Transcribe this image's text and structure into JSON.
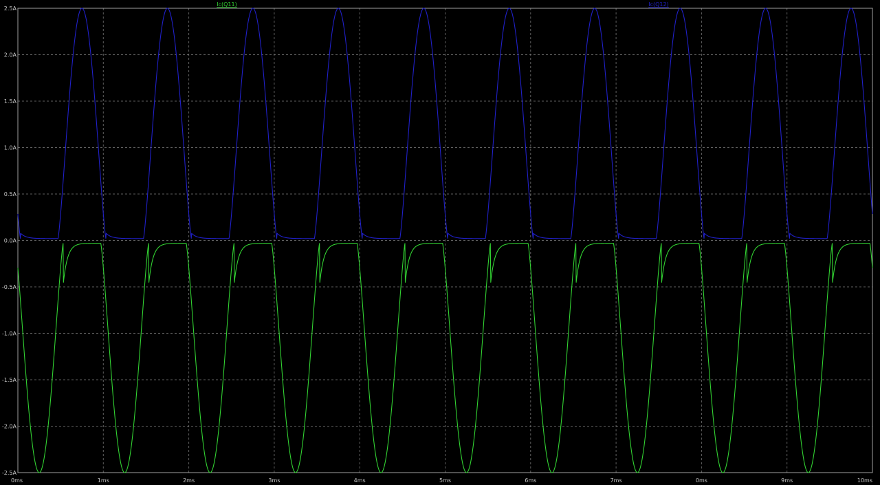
{
  "chart_data": {
    "type": "line",
    "background": "#000000",
    "grid": true,
    "xlim": [
      0,
      10
    ],
    "ylim": [
      -2.5,
      2.5
    ],
    "x_ticks": [
      0,
      1,
      2,
      3,
      4,
      5,
      6,
      7,
      8,
      9,
      10
    ],
    "x_tick_labels": [
      "0ms",
      "1ms",
      "2ms",
      "3ms",
      "4ms",
      "5ms",
      "6ms",
      "7ms",
      "0ms",
      "9ms",
      "10ms"
    ],
    "y_ticks": [
      2.5,
      2.0,
      1.5,
      1.0,
      0.5,
      0.0,
      -0.5,
      -1.0,
      -1.5,
      -2.0,
      -2.5
    ],
    "y_tick_labels": [
      "2.5A",
      "2.0A",
      "1.5A",
      "1.0A",
      "0.5A",
      "0.0A",
      "-0.5A",
      "-1.0A",
      "-1.5A",
      "-2.0A",
      "-2.5A"
    ],
    "period_ms": 1.0,
    "series": [
      {
        "name": "Ic(Q11)",
        "color": "#32d232",
        "peak": -2.5,
        "plateau": -0.03,
        "peak_x": [
          0.25,
          1.25,
          2.25,
          3.25,
          4.25,
          5.25,
          6.25,
          7.25,
          8.25,
          9.25
        ]
      },
      {
        "name": "Ic(Q12)",
        "color": "#2020c8",
        "peak": 2.5,
        "plateau": 0.02,
        "peak_x": [
          0.75,
          1.75,
          2.75,
          3.75,
          4.75,
          5.75,
          6.75,
          7.75,
          8.75,
          9.75
        ]
      }
    ]
  }
}
